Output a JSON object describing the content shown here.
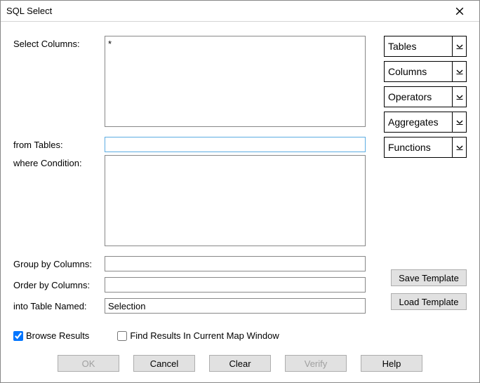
{
  "window": {
    "title": "SQL Select"
  },
  "labels": {
    "select_columns": "Select Columns:",
    "from_tables": "from Tables:",
    "where_condition": "where Condition:",
    "group_by": "Group by Columns:",
    "order_by": "Order by Columns:",
    "into_table": "into Table Named:"
  },
  "fields": {
    "select_columns": "*",
    "from_tables": "",
    "where_condition": "",
    "group_by": "",
    "order_by": "",
    "into_table": "Selection"
  },
  "dropdowns": {
    "tables": "Tables",
    "columns": "Columns",
    "operators": "Operators",
    "aggregates": "Aggregates",
    "functions": "Functions"
  },
  "templates": {
    "save": "Save Template",
    "load": "Load Template"
  },
  "checkboxes": {
    "browse_results": {
      "label": "Browse Results",
      "checked": true
    },
    "find_in_map": {
      "label": "Find Results In Current Map Window",
      "checked": false
    }
  },
  "buttons": {
    "ok": "OK",
    "cancel": "Cancel",
    "clear": "Clear",
    "verify": "Verify",
    "help": "Help"
  }
}
